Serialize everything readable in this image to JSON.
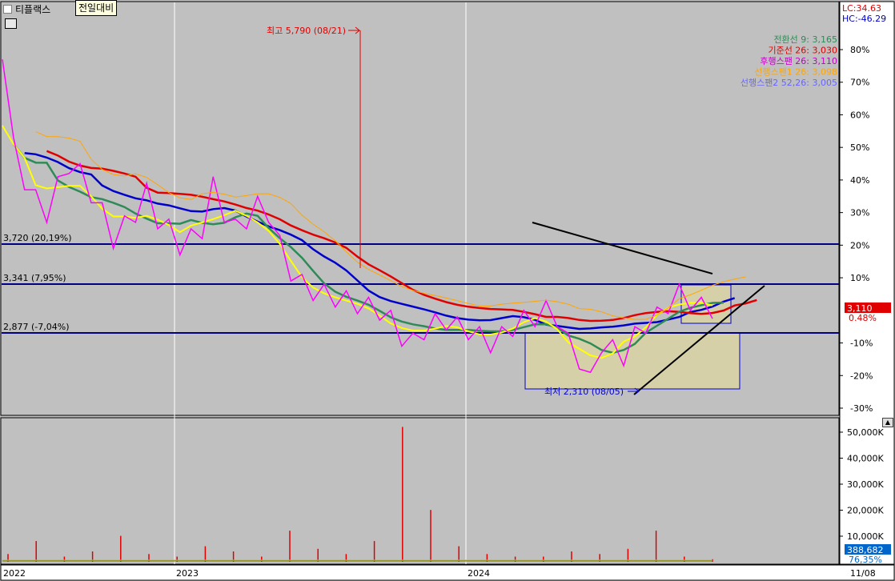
{
  "header": {
    "title": "티플랙스",
    "compare_button": "전일대비",
    "lc_label": "LC:34.63",
    "hc_label": "HC:-46.29"
  },
  "legend": [
    {
      "text": "전환선 9: 3,165",
      "color": "#2e8b57"
    },
    {
      "text": "기준선 26: 3,030",
      "color": "#e00000"
    },
    {
      "text": "후행스팬 26: 3,110",
      "color": "#c000c0"
    },
    {
      "text": "선행스팬1 26: 3,098",
      "color": "#ffa500"
    },
    {
      "text": "선행스팬2 52,26: 3,005",
      "color": "#6666ff"
    }
  ],
  "annotations": {
    "high": "최고 5,790 (08/21)",
    "low": "최저 2,310 (08/05)",
    "level1": "3,720 (20,19%)",
    "level2": "3,341 (7,95%)",
    "level3": "2,877 (-7,04%)",
    "current_price": "3,110",
    "current_pct": "0.48%",
    "volume_current": "388,682",
    "volume_pct": "76,35%"
  },
  "price_axis": [
    "80%",
    "70%",
    "60%",
    "50%",
    "40%",
    "30%",
    "20%",
    "10%",
    "-10%",
    "-20%",
    "-30%"
  ],
  "volume_axis": [
    "50,000K",
    "40,000K",
    "30,000K",
    "20,000K",
    "10,000K"
  ],
  "time_axis": [
    "2022",
    "2023",
    "2024",
    "11/08"
  ],
  "colors": {
    "background": "#c0c0c0",
    "price": "#ff00ff",
    "conversion": "#2e8b57",
    "base": "#e00000",
    "span1": "#ffa500",
    "span2": "#0000cc",
    "lagging": "#ffff00"
  },
  "chart_data": {
    "type": "line",
    "x": [
      "2022",
      "2023",
      "2024",
      "11/08"
    ],
    "series": [
      {
        "name": "전환선 9",
        "last": 3165
      },
      {
        "name": "기준선 26",
        "last": 3030
      },
      {
        "name": "후행스팬 26",
        "last": 3110
      },
      {
        "name": "선행스팬1 26",
        "last": 3098
      },
      {
        "name": "선행스팬2 52,26",
        "last": 3005
      }
    ],
    "price_points_pct": [
      80,
      50,
      40,
      34,
      30,
      38,
      45,
      42,
      36,
      30,
      22,
      26,
      30,
      36,
      28,
      25,
      20,
      22,
      25,
      38,
      30,
      25,
      28,
      32,
      30,
      20,
      12,
      8,
      6,
      5,
      4,
      3,
      2,
      1,
      0,
      -3,
      -8,
      -10,
      -6,
      -4,
      -3,
      -5,
      -6,
      -8,
      -10,
      -8,
      -5,
      -3,
      -2,
      0,
      -2,
      -10,
      -15,
      -22,
      -10,
      -12,
      -14,
      -8,
      -4,
      -2,
      2,
      5,
      3,
      1,
      0.48
    ],
    "volume_spikes_k": [
      3,
      8,
      2,
      4,
      10,
      3,
      2,
      6,
      4,
      2,
      12,
      5,
      3,
      8,
      52,
      20,
      6,
      3,
      2,
      2,
      4,
      3,
      5,
      12,
      2,
      1
    ],
    "levels": [
      {
        "price": 3720,
        "pct": 20.19
      },
      {
        "price": 3341,
        "pct": 7.95
      },
      {
        "price": 2877,
        "pct": -7.04
      }
    ],
    "high": {
      "price": 5790,
      "date": "08/21"
    },
    "low": {
      "price": 2310,
      "date": "08/05"
    },
    "ylim_pct": [
      -32,
      85
    ]
  }
}
